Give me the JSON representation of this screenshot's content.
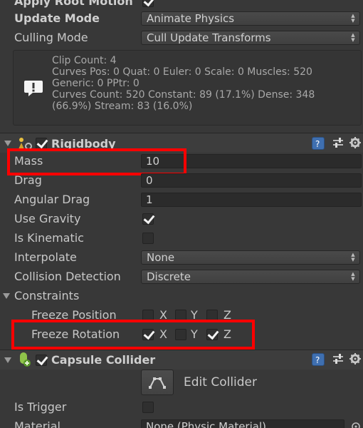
{
  "animator": {
    "apply_root_motion_label": "Apply Root Motion",
    "apply_root_motion_checked": true,
    "update_mode_label": "Update Mode",
    "update_mode_value": "Animate Physics",
    "culling_mode_label": "Culling Mode",
    "culling_mode_value": "Cull Update Transforms",
    "info_lines": [
      "Clip Count: 4",
      "Curves Pos: 0 Quat: 0 Euler: 0 Scale: 0 Muscles: 520",
      "Generic: 0 PPtr: 0",
      "Curves Count: 520 Constant: 89 (17.1%) Dense: 348",
      "(66.9%) Stream: 83 (16.0%)"
    ]
  },
  "rigidbody": {
    "title": "Rigidbody",
    "enabled": true,
    "mass_label": "Mass",
    "mass_value": "10",
    "drag_label": "Drag",
    "drag_value": "0",
    "angular_drag_label": "Angular Drag",
    "angular_drag_value": "1",
    "use_gravity_label": "Use Gravity",
    "use_gravity": true,
    "is_kinematic_label": "Is Kinematic",
    "is_kinematic": false,
    "interpolate_label": "Interpolate",
    "interpolate_value": "None",
    "collision_label": "Collision Detection",
    "collision_value": "Discrete",
    "constraints_label": "Constraints",
    "freeze_position_label": "Freeze Position",
    "freeze_position": {
      "x": false,
      "y": false,
      "z": false
    },
    "freeze_rotation_label": "Freeze Rotation",
    "freeze_rotation": {
      "x": true,
      "y": false,
      "z": true
    },
    "axis_x": "X",
    "axis_y": "Y",
    "axis_z": "Z"
  },
  "capsule": {
    "title": "Capsule Collider",
    "enabled": true,
    "edit_collider_label": "Edit Collider",
    "is_trigger_label": "Is Trigger",
    "is_trigger": false,
    "material_label": "Material",
    "material_value": "None (Physic Material)"
  },
  "colors": {
    "highlight": "#ff0000",
    "background": "#383838"
  }
}
